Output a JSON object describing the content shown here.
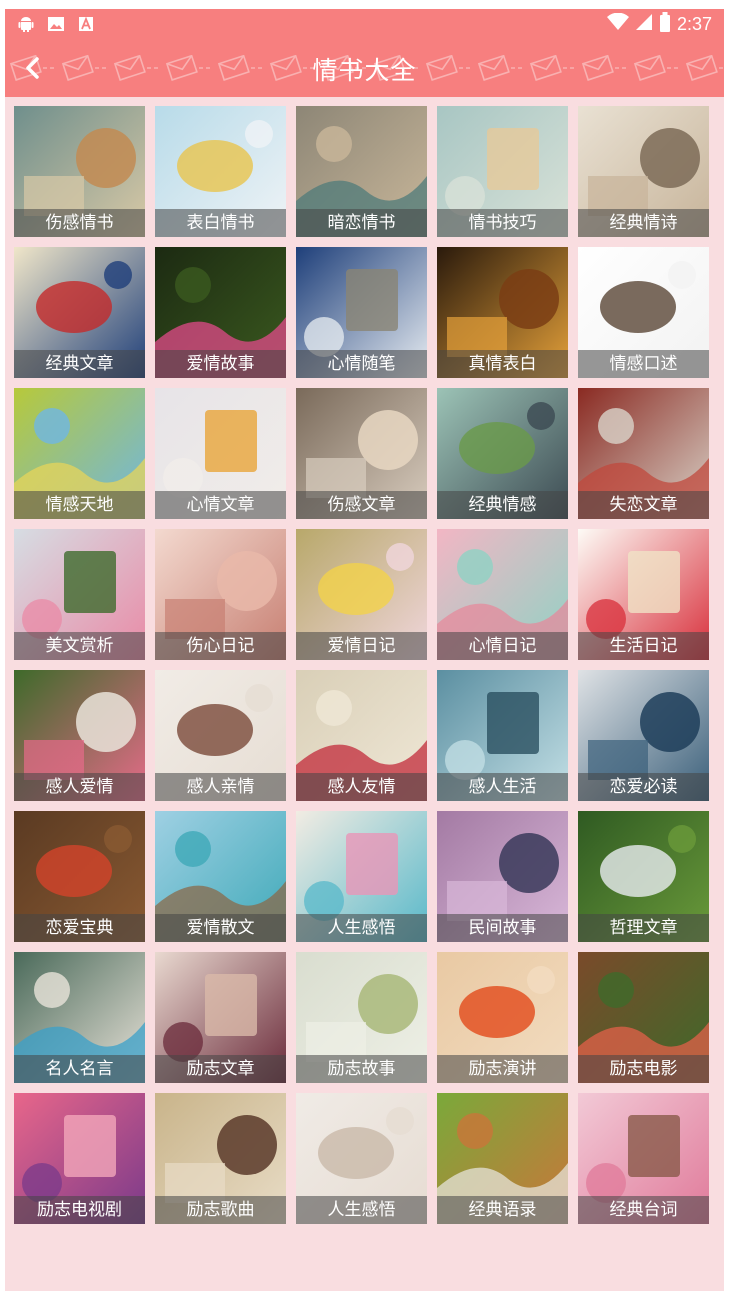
{
  "status_bar": {
    "time": "2:37",
    "left_icons": [
      "android-icon",
      "image-icon",
      "font-icon"
    ],
    "right_icons": [
      "wifi-icon",
      "signal-icon",
      "battery-icon"
    ]
  },
  "header": {
    "title": "情书大全",
    "back_icon": "chevron-left-icon",
    "background_color": "#f77f7f"
  },
  "page_background": "#f9dde0",
  "categories": [
    {
      "label": "伤感情书",
      "palette": [
        "#6f8f8c",
        "#d9c9a6",
        "#c28b52"
      ]
    },
    {
      "label": "表白情书",
      "palette": [
        "#b8dbe9",
        "#eff3f6",
        "#e8c44e"
      ]
    },
    {
      "label": "暗恋情书",
      "palette": [
        "#8d8676",
        "#c9b79a",
        "#4f7b7a"
      ]
    },
    {
      "label": "情书技巧",
      "palette": [
        "#a8c6c3",
        "#d9e2d8",
        "#e6c99a"
      ]
    },
    {
      "label": "经典情诗",
      "palette": [
        "#e9e1d3",
        "#c7b49a",
        "#7d6b57"
      ]
    },
    {
      "label": "经典文章",
      "palette": [
        "#f0e6c9",
        "#1f3f7a",
        "#c42a2a"
      ]
    },
    {
      "label": "爱情故事",
      "palette": [
        "#1c2a12",
        "#3b5a1f",
        "#e24a8a"
      ]
    },
    {
      "label": "心情随笔",
      "palette": [
        "#1e3f7a",
        "#e8edf2",
        "#8a8574"
      ]
    },
    {
      "label": "真情表白",
      "palette": [
        "#2a1a0c",
        "#e5a13a",
        "#7a3d14"
      ]
    },
    {
      "label": "情感口述",
      "palette": [
        "#ffffff",
        "#f2f2f2",
        "#5a4636"
      ]
    },
    {
      "label": "情感天地",
      "palette": [
        "#b7c93a",
        "#6fb6e3",
        "#e7d45a"
      ]
    },
    {
      "label": "心情文章",
      "palette": [
        "#e7e4e8",
        "#f1ede9",
        "#e8a53a"
      ]
    },
    {
      "label": "伤感文章",
      "palette": [
        "#7a6a5a",
        "#d9cdbf",
        "#e8d7c2"
      ]
    },
    {
      "label": "经典情感",
      "palette": [
        "#9cc3b6",
        "#3c4a52",
        "#6a9a4a"
      ]
    },
    {
      "label": "失恋文章",
      "palette": [
        "#8a2a22",
        "#d9d3c9",
        "#c0483c"
      ]
    },
    {
      "label": "美文赏析",
      "palette": [
        "#d6dde3",
        "#e98aa6",
        "#3f6b2d"
      ]
    },
    {
      "label": "伤心日记",
      "palette": [
        "#f3d9cf",
        "#c77f72",
        "#e9b9a9"
      ]
    },
    {
      "label": "爱情日记",
      "palette": [
        "#b8a86a",
        "#f0d6dc",
        "#f2d24a"
      ]
    },
    {
      "label": "心情日记",
      "palette": [
        "#f2b6c4",
        "#8fd2c4",
        "#e58a9c"
      ]
    },
    {
      "label": "生活日记",
      "palette": [
        "#fdfbf6",
        "#d82e3a",
        "#f0e2c6"
      ]
    },
    {
      "label": "感人爱情",
      "palette": [
        "#3e6a2a",
        "#e76b8a",
        "#e9e3d9"
      ]
    },
    {
      "label": "感人亲情",
      "palette": [
        "#f1ece6",
        "#e6ddd3",
        "#7a4a3a"
      ]
    },
    {
      "label": "感人友情",
      "palette": [
        "#d9cfb7",
        "#efe7d6",
        "#c22a3a"
      ]
    },
    {
      "label": "感人生活",
      "palette": [
        "#5b8fa1",
        "#c4e0e6",
        "#2a5060"
      ]
    },
    {
      "label": "恋爱必读",
      "palette": [
        "#dfe2e5",
        "#3a5f7a",
        "#1e3e5a"
      ]
    },
    {
      "label": "恋爱宝典",
      "palette": [
        "#5a3a22",
        "#8a5a32",
        "#d3432a"
      ]
    },
    {
      "label": "爱情散文",
      "palette": [
        "#9fd0e3",
        "#3ea9b8",
        "#8a6a4a"
      ]
    },
    {
      "label": "人生感悟",
      "palette": [
        "#f2ece3",
        "#57b8c9",
        "#e996b8"
      ]
    },
    {
      "label": "民间故事",
      "palette": [
        "#a37aa3",
        "#d9b8d9",
        "#3a3a5a"
      ]
    },
    {
      "label": "哲理文章",
      "palette": [
        "#2f5a22",
        "#6a9a3a",
        "#e9ecf0"
      ]
    },
    {
      "label": "名人名言",
      "palette": [
        "#4a6a5a",
        "#e9e3d9",
        "#3aa0c9"
      ]
    },
    {
      "label": "励志文章",
      "palette": [
        "#e9d9d0",
        "#6a2a3a",
        "#d9b9a9"
      ]
    },
    {
      "label": "励志故事",
      "palette": [
        "#d9ddcf",
        "#eef0e6",
        "#a9b87a"
      ]
    },
    {
      "label": "励志演讲",
      "palette": [
        "#e9c9a3",
        "#f2dcc0",
        "#e24a1a"
      ]
    },
    {
      "label": "励志电影",
      "palette": [
        "#7a4a2a",
        "#3e6a2a",
        "#e3604a"
      ]
    },
    {
      "label": "励志电视剧",
      "palette": [
        "#e8668a",
        "#7a3a8a",
        "#f2a6b9"
      ]
    },
    {
      "label": "励志歌曲",
      "palette": [
        "#c9b48a",
        "#e8dcc6",
        "#5a3a2a"
      ]
    },
    {
      "label": "人生感悟",
      "palette": [
        "#f0ebe6",
        "#e6dcd2",
        "#c9b9a9"
      ]
    },
    {
      "label": "经典语录",
      "palette": [
        "#7aa93a",
        "#c9763a",
        "#e6e3d9"
      ]
    },
    {
      "label": "经典台词",
      "palette": [
        "#f2c9d6",
        "#e07a9a",
        "#8a5a4a"
      ]
    }
  ]
}
